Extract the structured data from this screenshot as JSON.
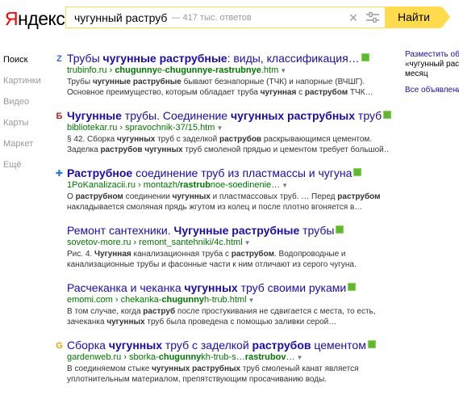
{
  "header": {
    "logo_first": "Я",
    "logo_rest": "ндекс",
    "search_value": "чугунный раструб",
    "search_hint": "— 417 тыс. ответов",
    "search_button": "Найти"
  },
  "nav": {
    "items": [
      "Поиск",
      "Картинки",
      "Видео",
      "Карты",
      "Маркет",
      "Ещё"
    ]
  },
  "results": [
    {
      "title_parts": [
        {
          "t": "Трубы "
        },
        {
          "t": "чугунные раструбные",
          "b": true
        },
        {
          "t": ": виды, классификация…"
        }
      ],
      "url_parts": [
        {
          "t": "trubinfo.ru › "
        },
        {
          "t": "chugunny",
          "b": true
        },
        {
          "t": "e-"
        },
        {
          "t": "chugunnye-rastrubnye",
          "b": true
        },
        {
          "t": ".htm"
        }
      ],
      "snippet": [
        [
          {
            "t": "Трубы "
          },
          {
            "t": "чугунные раструбные",
            "b": true
          },
          {
            "t": " бывают безнапорные (ТЧК) и напорные (ВЧШГ)."
          }
        ],
        [
          {
            "t": "Основное преимущество, которым обладает труба "
          },
          {
            "t": "чугунная",
            "b": true
          },
          {
            "t": " с "
          },
          {
            "t": "раструбом",
            "b": true
          },
          {
            "t": " ТЧК…"
          }
        ]
      ],
      "favicon": "Z",
      "favicon_color": "#3b6bc4"
    },
    {
      "title_parts": [
        {
          "t": "Чугунные",
          "b": true
        },
        {
          "t": " трубы. Соединение "
        },
        {
          "t": "чугунных раструбных",
          "b": true
        },
        {
          "t": " труб"
        }
      ],
      "url_parts": [
        {
          "t": "bibliotekar.ru › spravochnik-37/15.htm"
        }
      ],
      "snippet": [
        [
          {
            "t": "§ 42. Сборка "
          },
          {
            "t": "чугунных",
            "b": true
          },
          {
            "t": " труб с заделкой "
          },
          {
            "t": "раструбов",
            "b": true
          },
          {
            "t": " раскрывающимся цементом."
          }
        ],
        [
          {
            "t": "Заделка "
          },
          {
            "t": "раструбов чугунных",
            "b": true
          },
          {
            "t": " труб смоленой прядью и цементом требует большой…"
          }
        ]
      ],
      "favicon": "Б",
      "favicon_color": "#b22222"
    },
    {
      "title_parts": [
        {
          "t": "Раструбное",
          "b": true
        },
        {
          "t": " соединение труб из пластмассы и чугуна"
        }
      ],
      "url_parts": [
        {
          "t": "1PoKanalizacii.ru › montazh/"
        },
        {
          "t": "rastrub",
          "b": true
        },
        {
          "t": "noe-soedinenie…"
        }
      ],
      "snippet": [
        [
          {
            "t": "О "
          },
          {
            "t": "раструбном",
            "b": true
          },
          {
            "t": " соединении "
          },
          {
            "t": "чугунных",
            "b": true
          },
          {
            "t": " и пластмассовых труб. … Перед "
          },
          {
            "t": "раструбом",
            "b": true
          }
        ],
        [
          {
            "t": "накладывается смоляная прядь жгутом из колец и после плотно вгоняется в…"
          }
        ]
      ],
      "favicon": "✚",
      "favicon_color": "#2a7bd8"
    },
    {
      "title_parts": [
        {
          "t": "Ремонт сантехники. "
        },
        {
          "t": "Чугунные раструбные",
          "b": true
        },
        {
          "t": " трубы"
        }
      ],
      "url_parts": [
        {
          "t": "sovetov-more.ru › remont_santehniki/4c.html"
        }
      ],
      "snippet": [
        [
          {
            "t": "Рис. 4. "
          },
          {
            "t": "Чугунная",
            "b": true
          },
          {
            "t": " канализационная труба с "
          },
          {
            "t": "раструбом",
            "b": true
          },
          {
            "t": ". Водопроводные и"
          }
        ],
        [
          {
            "t": "канализационные трубы и фасонные части к ним отличают из серого чугуна."
          }
        ]
      ],
      "favicon": "",
      "favicon_color": "#ffffff"
    },
    {
      "title_parts": [
        {
          "t": "Расчеканка и чеканка "
        },
        {
          "t": "чугунных",
          "b": true
        },
        {
          "t": " труб своими руками"
        }
      ],
      "url_parts": [
        {
          "t": "emomi.com › chekanka-"
        },
        {
          "t": "chugunny",
          "b": true
        },
        {
          "t": "h-trub.html"
        }
      ],
      "snippet": [
        [
          {
            "t": "В том случае, когда "
          },
          {
            "t": "раструб",
            "b": true
          },
          {
            "t": " после простукивания не сдвигается с места, то есть,"
          }
        ],
        [
          {
            "t": "зачеканка "
          },
          {
            "t": "чугунных",
            "b": true
          },
          {
            "t": " труб была проведена с помощью заливки серой…"
          }
        ]
      ],
      "favicon": "",
      "favicon_color": "#ffffff"
    },
    {
      "title_parts": [
        {
          "t": "Сборка "
        },
        {
          "t": "чугунных",
          "b": true
        },
        {
          "t": " труб с заделкой "
        },
        {
          "t": "раструбов",
          "b": true
        },
        {
          "t": " цементом"
        }
      ],
      "url_parts": [
        {
          "t": "gardenweb.ru › sborka-"
        },
        {
          "t": "chugunny",
          "b": true
        },
        {
          "t": "kh-trub-s…"
        },
        {
          "t": "rastrubov",
          "b": true
        },
        {
          "t": "…"
        }
      ],
      "snippet": [
        [
          {
            "t": "В соединяемом стыке "
          },
          {
            "t": "чугунных раструбных",
            "b": true
          },
          {
            "t": " труб смоленый канат является"
          }
        ],
        [
          {
            "t": "уплотнительным материалом, препятствующим просачиванию воды."
          }
        ]
      ],
      "favicon": "G",
      "favicon_color": "#e8a400"
    }
  ],
  "ads": {
    "line1": "Разместить объ",
    "line2": "«чугунный раст",
    "line3": "месяц",
    "link": "Все объявлени"
  },
  "colors": {
    "accent": "#ffdb4d",
    "link": "#1a0dab",
    "url": "#007700",
    "badge": "#5fb82e"
  }
}
